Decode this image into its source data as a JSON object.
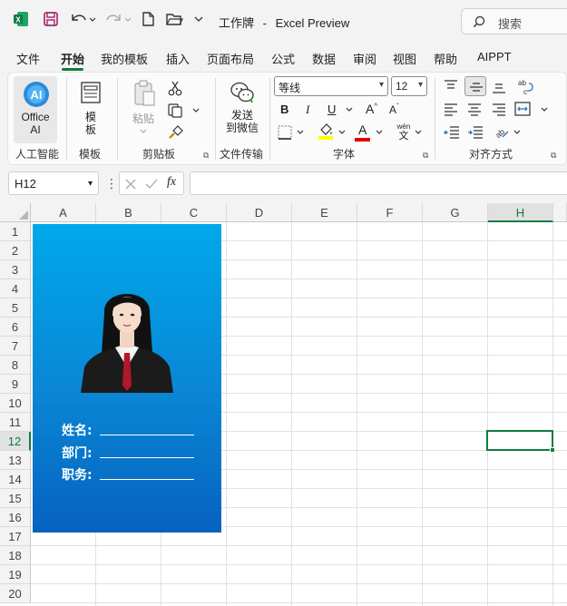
{
  "titlebar": {
    "filename": "工作牌",
    "separator": "-",
    "app": "Excel Preview",
    "search_placeholder": "搜索"
  },
  "menu": {
    "tabs": [
      "文件",
      "开始",
      "我的模板",
      "插入",
      "页面布局",
      "公式",
      "数据",
      "审阅",
      "视图",
      "帮助",
      "AIPPT"
    ],
    "active": "开始"
  },
  "ribbon": {
    "office_ai": {
      "line1": "Office",
      "line2": "AI",
      "group": "人工智能"
    },
    "template": {
      "line1": "模",
      "line2": "板",
      "group": "模板"
    },
    "clipboard": {
      "paste": "粘贴",
      "group": "剪贴板"
    },
    "wechat": {
      "line1": "发送",
      "line2": "到微信",
      "group": "文件传输"
    },
    "font": {
      "name": "等线",
      "size": "12",
      "bold": "B",
      "italic": "I",
      "underline": "U",
      "grow": "A",
      "shrink": "A",
      "color_letter": "A",
      "phonetic_top": "wén",
      "phonetic_bottom": "文",
      "group": "字体"
    },
    "align": {
      "group": "对齐方式"
    }
  },
  "formula_bar": {
    "name_box": "H12",
    "fx": "fx",
    "formula": ""
  },
  "sheet": {
    "columns": [
      "A",
      "B",
      "C",
      "D",
      "E",
      "F",
      "G",
      "H"
    ],
    "rows": [
      "1",
      "2",
      "3",
      "4",
      "5",
      "6",
      "7",
      "8",
      "9",
      "10",
      "11",
      "12",
      "13",
      "14",
      "15",
      "16",
      "17",
      "18",
      "19",
      "20"
    ],
    "selected_column": "H",
    "selected_row": "12"
  },
  "badge": {
    "fields": [
      {
        "label": "姓名:"
      },
      {
        "label": "部门:"
      },
      {
        "label": "职务:"
      }
    ]
  },
  "colors": {
    "accent": "#107c41",
    "badge_top": "#00a8ea",
    "badge_bottom": "#0562bf"
  }
}
